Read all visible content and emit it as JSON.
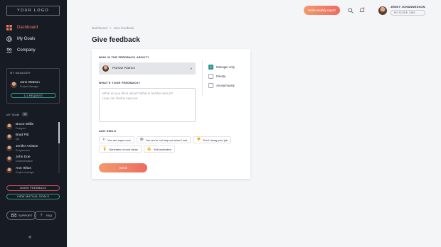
{
  "sidebar": {
    "logo": "YOUR LOGO",
    "nav": [
      {
        "label": "Dashboard",
        "icon": "dashboard-icon",
        "active": true
      },
      {
        "label": "My Goals",
        "icon": "goals-icon",
        "active": false
      },
      {
        "label": "Company",
        "icon": "company-icon",
        "active": false
      }
    ],
    "manager": {
      "caption": "MY MANAGER",
      "name": "Jane Watson",
      "role": "Project Manager",
      "request_label": "1:1 REQUEST"
    },
    "team": {
      "caption": "MY TEAM",
      "count": "12",
      "members": [
        {
          "name": "Bruce Willis",
          "role": "Designer"
        },
        {
          "name": "Brad Pitt",
          "role": "QA"
        },
        {
          "name": "Jenifer Aniston",
          "role": "Programmer"
        },
        {
          "name": "John Doe",
          "role": "Documentation"
        },
        {
          "name": "Ann Hilton",
          "role": "Project manager"
        }
      ]
    },
    "leave_feedback": "LEAVE FEEDBACK",
    "view_goals": "VIEW MUTUAL GOALS",
    "support": "SUPPORT",
    "faq": "FAQ",
    "collapse": "«"
  },
  "topbar": {
    "weekly_report": "Write weekly report",
    "user_name": "JENNY JOHANNESSON",
    "score": "MY SCORE: 3289"
  },
  "breadcrumb": {
    "home": "Dashboard",
    "sep": ">",
    "current": "Give feedback"
  },
  "page_title": "Give feedback",
  "form": {
    "about_label": "WHO IS THE FEEDBACK ABOUT?",
    "selected_person": "Roman Ratnov",
    "visibility": [
      {
        "label": "Manager only",
        "checked": true
      },
      {
        "label": "Private",
        "checked": false
      },
      {
        "label": "Anonymously",
        "checked": false
      }
    ],
    "feedback_label": "WHAT'S YOUR FEEDBACK?",
    "feedback_placeholder_1": "What do you think about? What is he/she best at?",
    "feedback_placeholder_2": "How can she/he improve",
    "emoji_label": "ADD EMOJI",
    "emojis": [
      {
        "icon": "✌",
        "label": "You are super cool"
      },
      {
        "icon": "😒",
        "label": "You are're not help me when I ask"
      },
      {
        "icon": "👎",
        "label": "Don't doing your job"
      },
      {
        "icon": "💡",
        "label": "Generator of cool ideas"
      },
      {
        "icon": "💪",
        "label": "Self-motivated"
      }
    ],
    "send_label": "Send"
  }
}
